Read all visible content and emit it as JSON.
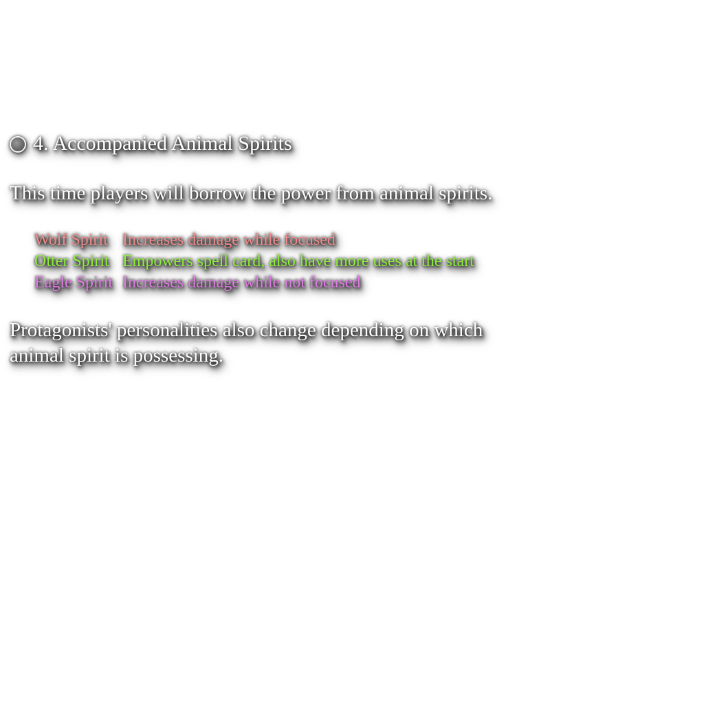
{
  "section": {
    "number_title": "4. Accompanied Animal Spirits",
    "intro": "This time players will borrow the power from animal spirits.",
    "spirits": [
      {
        "name": "Wolf Spirit",
        "effect": "Increases damage while focused",
        "color": "#f08a8a"
      },
      {
        "name": "Otter Spirit",
        "effect": "Empowers spell card, also have more uses at the start",
        "color": "#8cf03a"
      },
      {
        "name": "Eagle Spirit",
        "effect": "Increases damage while not focused",
        "color": "#e27ae8"
      }
    ],
    "outro": "Protagonists' personalities also change depending on which animal spirit is possessing."
  },
  "colors": {
    "text": "#ffffff",
    "shadow": "#000000",
    "background": "#ffffff"
  },
  "icons": {
    "bullet": "radio-circle-icon"
  }
}
